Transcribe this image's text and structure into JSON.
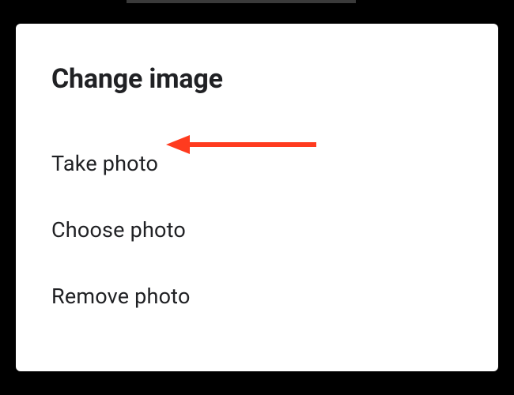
{
  "dialog": {
    "title": "Change image",
    "options": [
      {
        "label": "Take photo"
      },
      {
        "label": "Choose photo"
      },
      {
        "label": "Remove photo"
      }
    ]
  },
  "annotation": {
    "color": "#ff3b1f"
  }
}
